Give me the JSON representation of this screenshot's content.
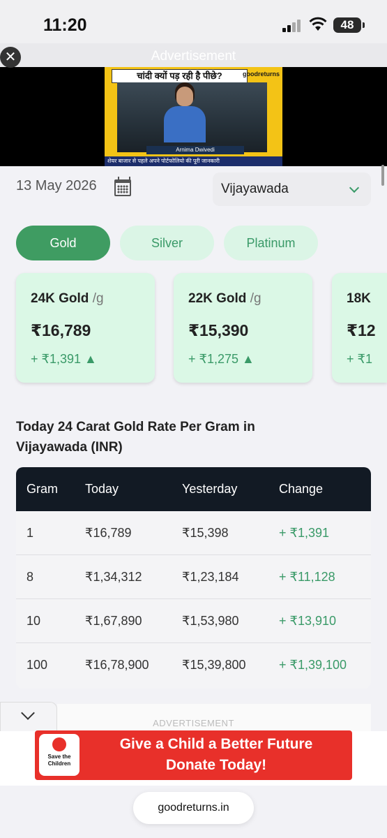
{
  "status_bar": {
    "time": "11:20",
    "battery": "48"
  },
  "top_ad": {
    "label": "Advertisement",
    "close_icon": "close-icon",
    "headline": "चांदी क्यों पड़ रही है पीछे?",
    "brand": "goodreturns",
    "presenter": "Arnima Dwivedi",
    "ticker": "शेयर बाजार से पहले अपने पोर्टफोलियो की पूरी जानकारी"
  },
  "filters": {
    "date": "13 May 2026",
    "calendar_icon": "calendar-icon",
    "city": "Vijayawada"
  },
  "metal_tabs": [
    {
      "label": "Gold",
      "active": true
    },
    {
      "label": "Silver",
      "active": false
    },
    {
      "label": "Platinum",
      "active": false
    }
  ],
  "rate_cards": [
    {
      "title": "24K Gold",
      "unit": "/g",
      "price": "₹16,789",
      "change": "+ ₹1,391",
      "arrow": "▲"
    },
    {
      "title": "22K Gold",
      "unit": "/g",
      "price": "₹15,390",
      "change": "+ ₹1,275",
      "arrow": "▲"
    },
    {
      "title": "18K",
      "unit": "",
      "price": "₹12",
      "change": "+ ₹1",
      "arrow": ""
    }
  ],
  "section_title": "Today 24 Carat Gold Rate Per Gram in Vijayawada (INR)",
  "table": {
    "headers": [
      "Gram",
      "Today",
      "Yesterday",
      "Change"
    ],
    "rows": [
      [
        "1",
        "₹16,789",
        "₹15,398",
        "+ ₹1,391"
      ],
      [
        "8",
        "₹1,34,312",
        "₹1,23,184",
        "+ ₹11,128"
      ],
      [
        "10",
        "₹1,67,890",
        "₹1,53,980",
        "+ ₹13,910"
      ],
      [
        "100",
        "₹16,78,900",
        "₹15,39,800",
        "+ ₹1,39,100"
      ]
    ]
  },
  "bottom_ad": {
    "label": "ADVERTISEMENT",
    "logo_text": "Save the Children",
    "line1": "Give a Child a Better Future",
    "line2": "Donate Today!"
  },
  "browser": {
    "url": "goodreturns.in"
  },
  "colors": {
    "accent_green": "#3f9c62",
    "card_bg": "#dbf8e6",
    "table_header": "#121a24",
    "donate_red": "#e8302a"
  }
}
